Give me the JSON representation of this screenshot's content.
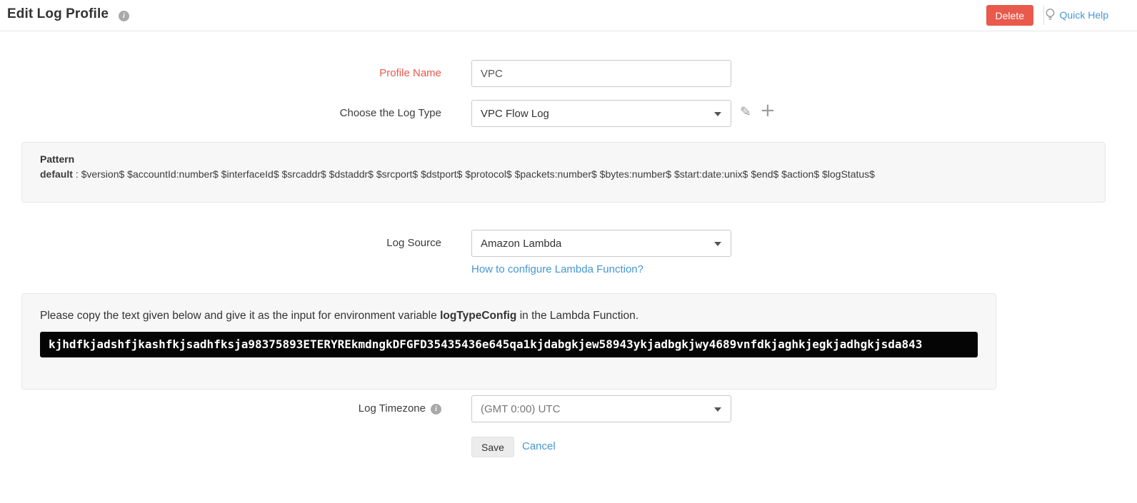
{
  "header": {
    "title": "Edit Log Profile",
    "delete_label": "Delete",
    "quick_help_label": "Quick Help"
  },
  "form": {
    "profile_name": {
      "label": "Profile Name",
      "value": "VPC"
    },
    "log_type": {
      "label": "Choose the Log Type",
      "selected": "VPC Flow Log"
    },
    "pattern": {
      "title": "Pattern",
      "name": "default",
      "separator": " : ",
      "value": "$version$ $accountId:number$ $interfaceId$ $srcaddr$ $dstaddr$ $srcport$ $dstport$ $protocol$ $packets:number$ $bytes:number$ $start:date:unix$ $end$ $action$ $logStatus$"
    },
    "log_source": {
      "label": "Log Source",
      "selected": "Amazon Lambda",
      "help_link": "How to configure Lambda Function?"
    },
    "lambda_box": {
      "instruction_prefix": "Please copy the text given below and give it as the input for environment variable ",
      "instruction_bold": "logTypeConfig",
      "instruction_suffix": " in the Lambda Function.",
      "token": "kjhdfkjadshfjkashfkjsadhfksja98375893ETERYREkmdngkDFGFD35435436e645qa1kjdabgkjew58943ykjadbgkjwy4689vnfdkjaghkjegkjadhgkjsda843"
    },
    "log_timezone": {
      "label": "Log Timezone",
      "selected": "(GMT 0:00) UTC"
    },
    "actions": {
      "save_label": "Save",
      "cancel_label": "Cancel"
    }
  },
  "icons": {
    "info": "i",
    "pencil": "✎",
    "plus": "+"
  },
  "colors": {
    "accent_red": "#e9594c",
    "link_blue": "#4596d3",
    "panel_gray": "#f7f7f7",
    "token_bg": "#050505"
  }
}
